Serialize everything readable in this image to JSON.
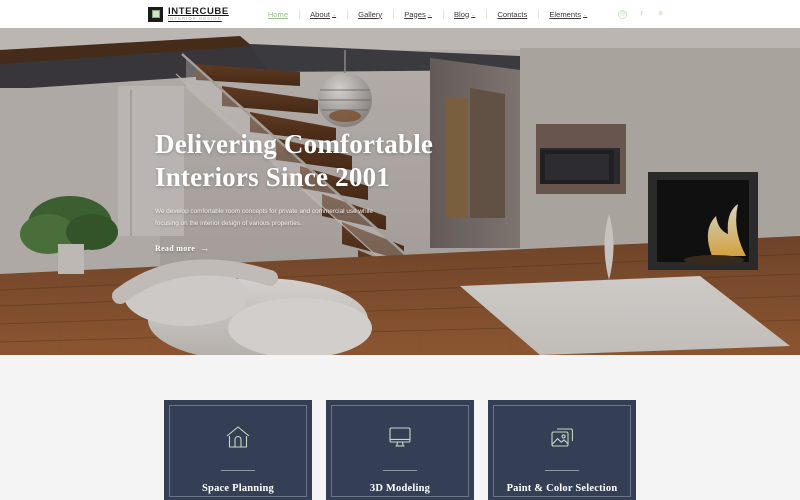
{
  "brand": {
    "name": "INTERCUBE",
    "tagline": "INTERIOR DESIGN",
    "logo_icon": "cube-logo-icon"
  },
  "nav": {
    "items": [
      {
        "label": "Home",
        "active": true,
        "has_dropdown": false
      },
      {
        "label": "About",
        "active": false,
        "has_dropdown": true
      },
      {
        "label": "Gallery",
        "active": false,
        "has_dropdown": false
      },
      {
        "label": "Pages",
        "active": false,
        "has_dropdown": true
      },
      {
        "label": "Blog",
        "active": false,
        "has_dropdown": true
      },
      {
        "label": "Contacts",
        "active": false,
        "has_dropdown": false
      },
      {
        "label": "Elements",
        "active": false,
        "has_dropdown": true
      }
    ],
    "caret": "⌄"
  },
  "social": {
    "items": [
      {
        "name": "instagram-icon",
        "glyph": "◎"
      },
      {
        "name": "facebook-icon",
        "glyph": "f"
      },
      {
        "name": "google-plus-icon",
        "glyph": "⊕"
      }
    ]
  },
  "hero": {
    "title_line1": "Delivering Comfortable",
    "title_line2": "Interiors Since 2001",
    "description": "We develop comfortable room concepts for private and commercial use while focusing on the interior design of various properties.",
    "cta_label": "Read more",
    "cta_arrow": "→"
  },
  "services": {
    "cards": [
      {
        "title": "Space Planning",
        "icon": "house-icon"
      },
      {
        "title": "3D Modeling",
        "icon": "monitor-icon"
      },
      {
        "title": "Paint & Color Selection",
        "icon": "image-stack-icon"
      }
    ]
  },
  "colors": {
    "accent_green": "#9cc08f",
    "card_navy": "#343f56",
    "header_bg": "#ffffff",
    "section_bg": "#f4f4f4",
    "nav_text": "#3b3b3b"
  }
}
